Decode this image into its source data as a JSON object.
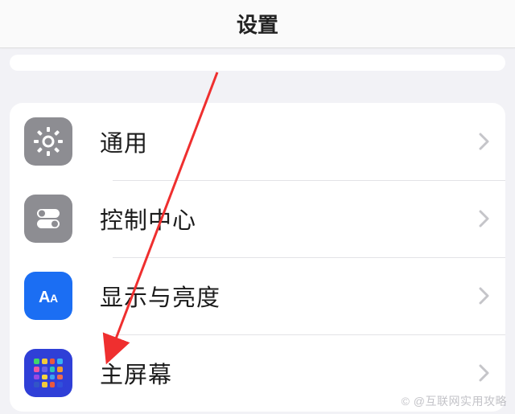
{
  "header": {
    "title": "设置"
  },
  "menu": {
    "general": {
      "label": "通用"
    },
    "controlCenter": {
      "label": "控制中心"
    },
    "display": {
      "label": "显示与亮度"
    },
    "homeScreen": {
      "label": "主屏幕"
    }
  },
  "hsColors": [
    "#40d66b",
    "#f2c93b",
    "#e9583e",
    "#36b2f2",
    "#f054a2",
    "#6860e6",
    "#2cc6b5",
    "#f09b2e",
    "#9a49e3",
    "#f5d43c",
    "#3ba2f2",
    "#ef6b4c"
  ],
  "watermark": "© @互联网实用攻略"
}
